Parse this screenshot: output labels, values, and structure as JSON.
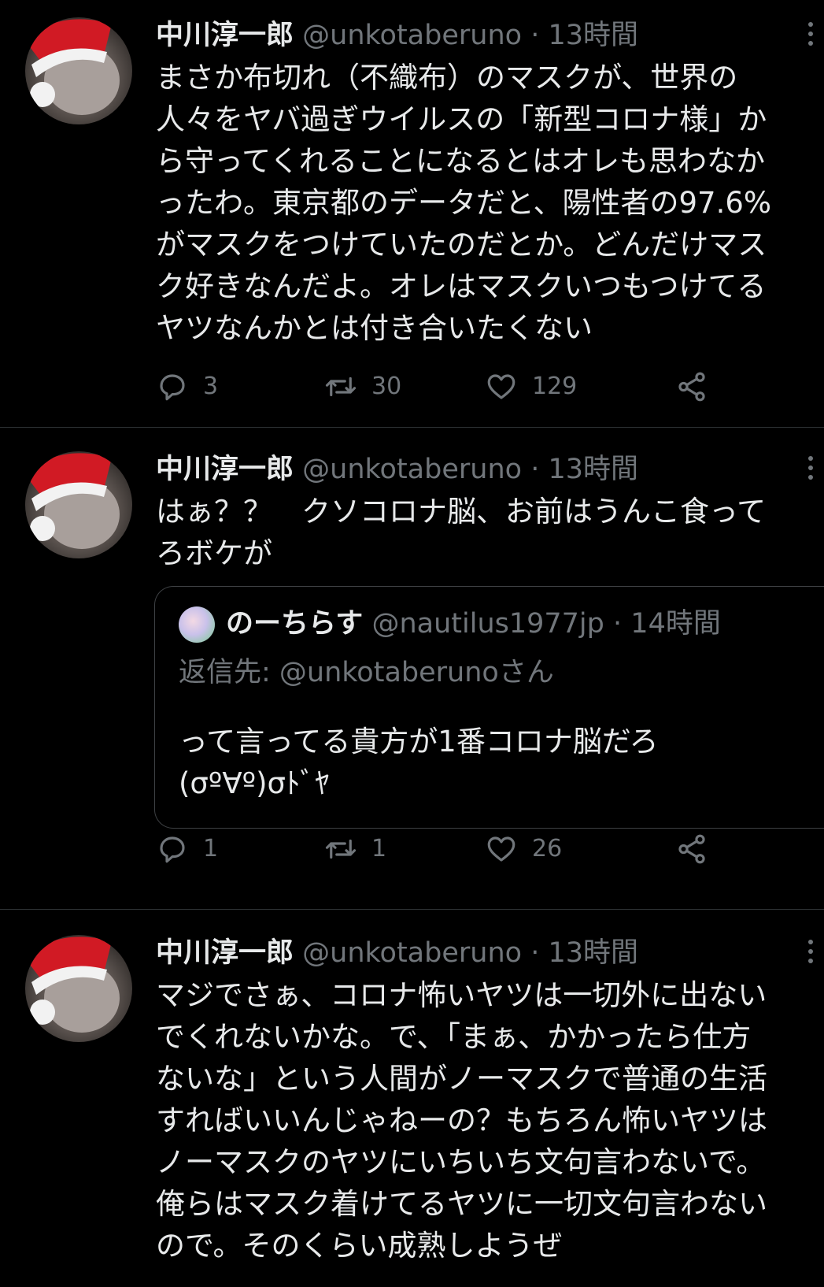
{
  "tweets": [
    {
      "name": "中川淳一郎",
      "handle": "@unkotaberuno",
      "separator": "·",
      "time": "13時間",
      "text": "まさか布切れ（不織布）のマスクが、世界の\n人々をヤバ過ぎウイルスの「新型コロナ様」か\nら守ってくれることになるとはオレも思わなか\nったわ。東京都のデータだと、陽性者の97.6%\nがマスクをつけていたのだとか。どんだけマス\nク好きなんだよ。オレはマスクいつもつけてる\nヤツなんかとは付き合いたくない",
      "replies": "3",
      "retweets": "30",
      "likes": "129"
    },
    {
      "name": "中川淳一郎",
      "handle": "@unkotaberuno",
      "separator": "·",
      "time": "13時間",
      "text": "はぁ？？　クソコロナ脳、お前はうんこ食って\nろボケが",
      "quote": {
        "name": "のーちらす",
        "handle": "@nautilus1977jp",
        "separator": "·",
        "time": "14時間",
        "reply_label": "返信先: ",
        "reply_mention": "@unkotaberuno",
        "reply_suffix": "さん",
        "text": "って言ってる貴方が1番コロナ脳だろ\n(σº∀º)σﾄﾞﾔ"
      },
      "replies": "1",
      "retweets": "1",
      "likes": "26"
    },
    {
      "name": "中川淳一郎",
      "handle": "@unkotaberuno",
      "separator": "·",
      "time": "13時間",
      "text": "マジでさぁ、コロナ怖いヤツは一切外に出ない\nでくれないかな。で、「まぁ、かかったら仕方\nないな」という人間がノーマスクで普通の生活\nすればいいんじゃねーの？もちろん怖いヤツは\nノーマスクのヤツにいちいち文句言わないで。\n俺らはマスク着けてるヤツに一切文句言わない\nので。そのくらい成熟しようぜ"
    }
  ],
  "icons": {
    "reply": "reply-icon",
    "retweet": "retweet-icon",
    "like": "heart-icon",
    "share": "share-icon",
    "more": "more-vertical-icon"
  },
  "colors": {
    "background": "#000000",
    "text": "#e7e9ea",
    "secondary": "#71767b",
    "divider": "#2f3336"
  }
}
